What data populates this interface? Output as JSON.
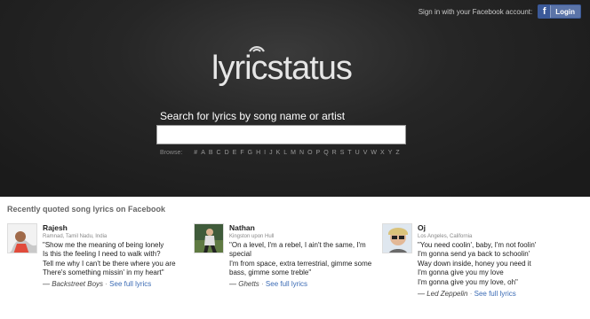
{
  "header": {
    "signin_text": "Sign in with your Facebook account:",
    "fb_icon": "f",
    "login_label": "Login"
  },
  "logo": {
    "light": "lyric",
    "bold": "",
    "rest": "status"
  },
  "search": {
    "label": "Search for lyrics by song name or artist",
    "value": "",
    "placeholder": ""
  },
  "browse": {
    "label": "Browse:",
    "letters": [
      "#",
      "A",
      "B",
      "C",
      "D",
      "E",
      "F",
      "G",
      "H",
      "I",
      "J",
      "K",
      "L",
      "M",
      "N",
      "O",
      "P",
      "Q",
      "R",
      "S",
      "T",
      "U",
      "V",
      "W",
      "X",
      "Y",
      "Z"
    ]
  },
  "recent": {
    "title": "Recently quoted song lyrics on Facebook",
    "see_full": "See full lyrics",
    "quotes": [
      {
        "name": "Rajesh",
        "location": "Ramnad, Tamil Nadu, India",
        "lines": [
          "\"Show me the meaning of being lonely",
          "Is this the feeling I need to walk with?",
          "Tell me why I can't be there where you are",
          "There's something missin' in my heart\""
        ],
        "artist": "— Backstreet Boys"
      },
      {
        "name": "Nathan",
        "location": "Kingston upon Hull",
        "lines": [
          "\"On a level, I'm a rebel, I ain't the same, I'm",
          "special",
          "I'm from space, extra terrestrial, gimme some",
          "bass, gimme some treble\""
        ],
        "artist": "— Ghetts"
      },
      {
        "name": "Oj",
        "location": "Los Angeles, California",
        "lines": [
          "\"You need coolin', baby, I'm not foolin'",
          "I'm gonna send ya back to schoolin'",
          "Way down inside, honey you need it",
          "I'm gonna give you my love",
          "I'm gonna give you my love, oh\""
        ],
        "artist": "— Led Zeppelin"
      }
    ]
  }
}
